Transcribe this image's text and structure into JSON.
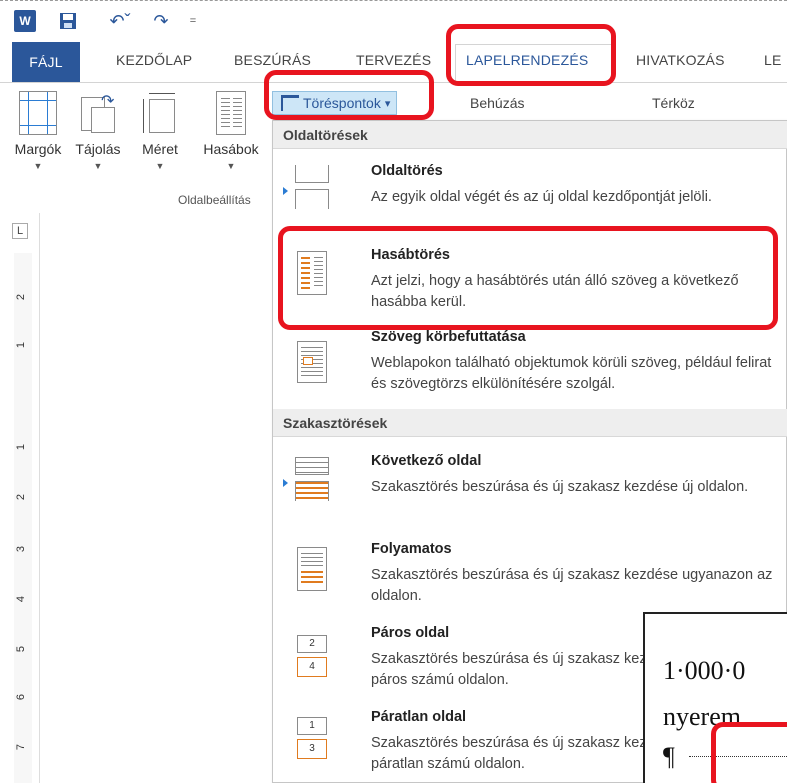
{
  "qat": {
    "app_logo": "W",
    "icons": [
      "word-icon",
      "save-icon",
      "undo-icon",
      "redo-icon",
      "customize-arrow-icon"
    ],
    "undo_glyph": "↶ˇ",
    "redo_glyph": "↷",
    "more_glyph": "="
  },
  "tabs": {
    "file": "FÁJL",
    "home": "KEZDŐLAP",
    "insert": "BESZÚRÁS",
    "design": "TERVEZÉS",
    "layout": "LAPELRENDEZÉS",
    "references": "HIVATKOZÁS",
    "more": "LE"
  },
  "ribbon": {
    "margins": "Margók",
    "orientation": "Tájolás",
    "size": "Méret",
    "columns": "Hasábok",
    "group_page_setup": "Oldalbeállítás",
    "breaks": "Töréspontok",
    "breaks_caret": "▾",
    "indent": "Behúzás",
    "spacing": "Térköz"
  },
  "ruler": {
    "tab_selector": "L",
    "numbers": [
      "2",
      "1",
      "1",
      "2",
      "3",
      "4",
      "5",
      "6",
      "7"
    ]
  },
  "menu": {
    "page_breaks_header": "Oldaltörések",
    "section_breaks_header": "Szakasztörések",
    "items": [
      {
        "title": "Oldaltörés",
        "desc": "Az egyik oldal végét és az új oldal kezdőpontját jelöli."
      },
      {
        "title": "Hasábtörés",
        "desc": "Azt jelzi, hogy a hasábtörés után álló szöveg a következő hasábba kerül."
      },
      {
        "title": "Szöveg körbefuttatása",
        "desc": "Weblapokon található objektumok körüli szöveg, például felirat és szövegtörzs elkülönítésére szolgál."
      },
      {
        "title": "Következő oldal",
        "desc": "Szakasztörés beszúrása és új szakasz kezdése új oldalon."
      },
      {
        "title": "Folyamatos",
        "desc": "Szakasztörés beszúrása és új szakasz kezdése ugyanazon az oldalon."
      },
      {
        "title": "Páros oldal",
        "desc": "Szakasztörés beszúrása és új szakasz kezdése a következő páros számú oldalon."
      },
      {
        "title": "Páratlan oldal",
        "desc": "Szakasztörés beszúrása és új szakasz kezdése a következő páratlan számú oldalon."
      }
    ],
    "even_icon_nums": [
      "2",
      "4"
    ],
    "odd_icon_nums": [
      "1",
      "3"
    ]
  },
  "document": {
    "line1": "1·000·0",
    "line2": "nyerem",
    "pilcrow": "¶"
  },
  "highlight_color": "#e8141f",
  "accent_color": "#2b579a"
}
